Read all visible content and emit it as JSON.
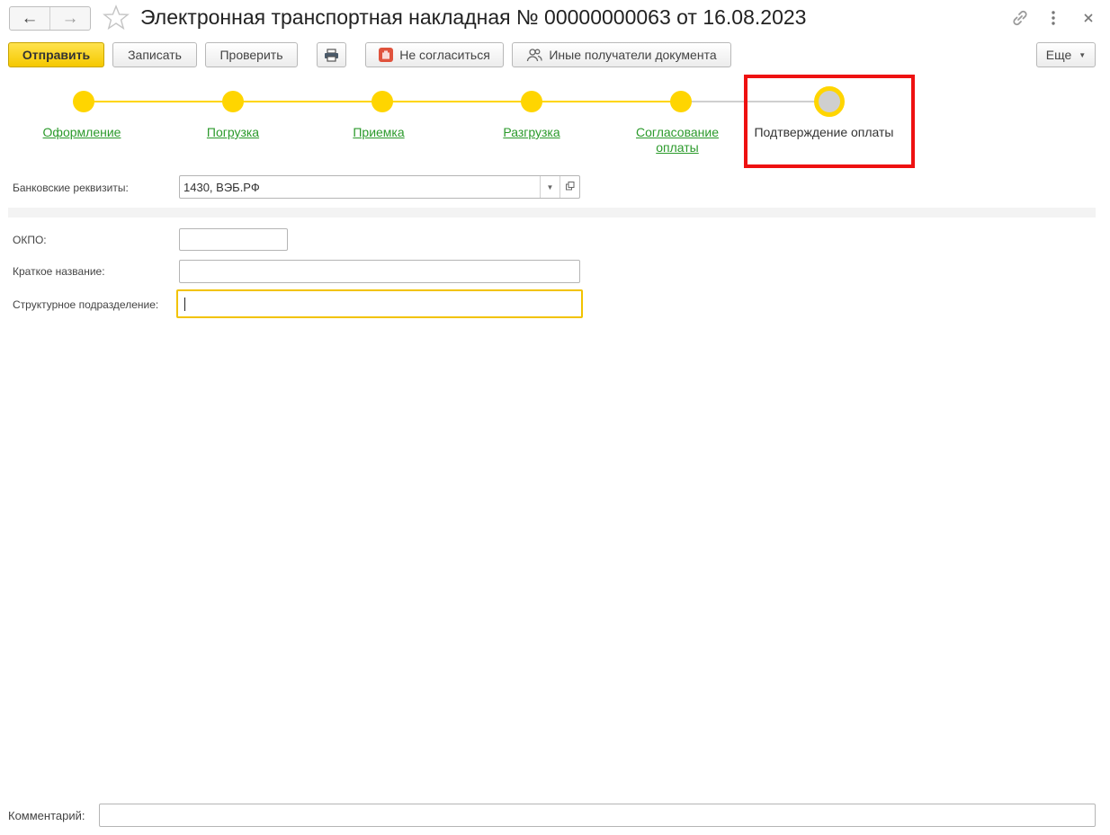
{
  "window": {
    "title": "Электронная транспортная накладная № 00000000063 от 16.08.2023"
  },
  "toolbar": {
    "send_label": "Отправить",
    "save_label": "Записать",
    "check_label": "Проверить",
    "disagree_label": "Не согласиться",
    "recipients_label": "Иные получатели документа",
    "more_label": "Еще"
  },
  "steps": [
    {
      "label": "Оформление",
      "state": "done"
    },
    {
      "label": "Погрузка",
      "state": "done"
    },
    {
      "label": "Приемка",
      "state": "done"
    },
    {
      "label": "Разгрузка",
      "state": "done"
    },
    {
      "label": "Согласование оплаты",
      "state": "done"
    },
    {
      "label": "Подтверждение оплаты",
      "state": "current"
    }
  ],
  "form": {
    "bank_label": "Банковские реквизиты:",
    "bank_value": "1430, ВЭБ.РФ",
    "okpo_label": "ОКПО:",
    "okpo_value": "",
    "short_name_label": "Краткое название:",
    "short_name_value": "",
    "division_label": "Структурное подразделение:",
    "division_value": ""
  },
  "footer": {
    "comment_label": "Комментарий:",
    "comment_value": ""
  },
  "colors": {
    "accent": "#ffd500",
    "link_green": "#2b9a2b",
    "highlight_red": "#ee1111",
    "pending_gray": "#cfcfcf"
  }
}
